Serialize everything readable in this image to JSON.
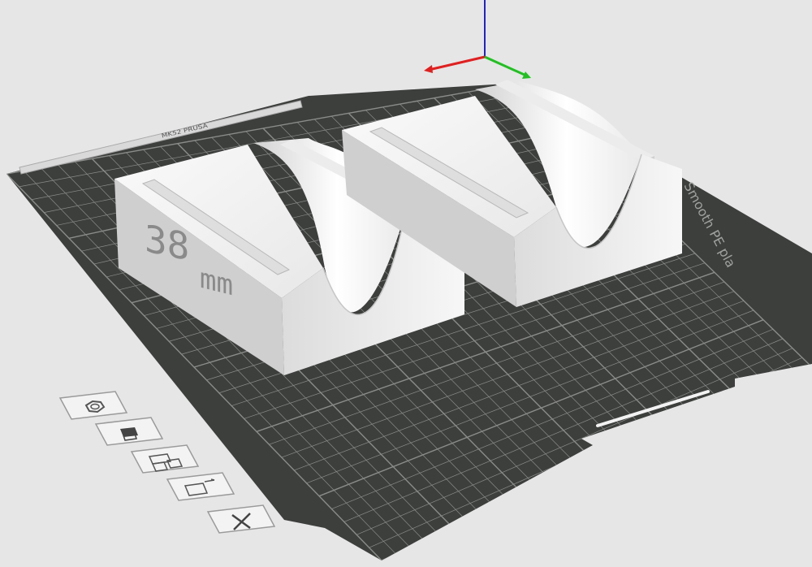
{
  "viewport": {
    "background": "#e6e6e6",
    "bed_color": "#3d3f3d",
    "grid_color": "#8a8c89",
    "model_color": "#f2f2f2"
  },
  "axes": {
    "x_color": "#e02020",
    "y_color": "#20c020",
    "z_color": "#2020d0"
  },
  "plate": {
    "label_right": "Smooth PE pla",
    "label_back": "MK52 PRUSA"
  },
  "model": {
    "emboss_number": "38",
    "emboss_unit": "mm"
  },
  "toolbar": {
    "items": [
      {
        "name": "settings-button",
        "icon": "gear-icon"
      },
      {
        "name": "import-button",
        "icon": "import-icon"
      },
      {
        "name": "layout-button",
        "icon": "layout-icon"
      },
      {
        "name": "export-button",
        "icon": "export-icon"
      },
      {
        "name": "delete-button",
        "icon": "close-icon"
      }
    ]
  }
}
